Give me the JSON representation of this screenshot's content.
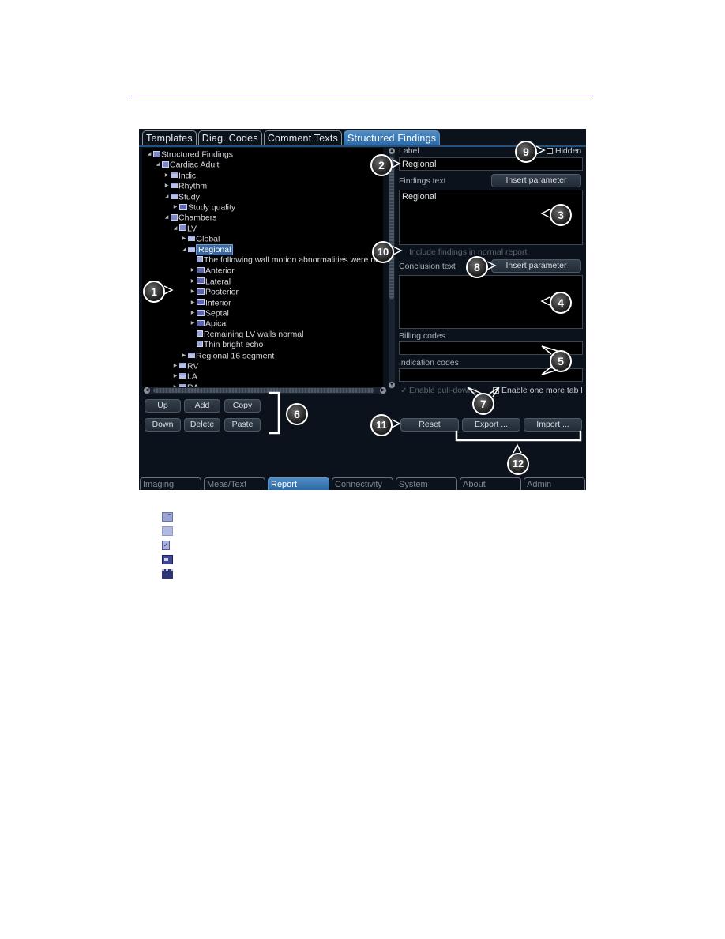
{
  "tabs": [
    {
      "label": "Templates",
      "active": false
    },
    {
      "label": "Diag. Codes",
      "active": false
    },
    {
      "label": "Comment Texts",
      "active": false
    },
    {
      "label": "Structured Findings",
      "active": true
    }
  ],
  "tree": {
    "nodes": [
      {
        "label": "Structured Findings",
        "expanded": true,
        "icon": "group-folder-icon"
      },
      {
        "label": "Cardiac Adult",
        "expanded": true,
        "icon": "group-folder-icon"
      },
      {
        "label": "Indic.",
        "expanded": false,
        "icon": "folder-icon"
      },
      {
        "label": "Rhythm",
        "expanded": false,
        "icon": "folder-icon"
      },
      {
        "label": "Study",
        "expanded": true,
        "icon": "folder-icon"
      },
      {
        "label": "Study quality",
        "expanded": false,
        "icon": "list-icon"
      },
      {
        "label": "Chambers",
        "expanded": true,
        "icon": "group-folder-icon"
      },
      {
        "label": "LV",
        "expanded": true,
        "icon": "group-folder-icon"
      },
      {
        "label": "Global",
        "expanded": false,
        "icon": "folder-icon"
      },
      {
        "label": "Regional",
        "expanded": true,
        "icon": "folder-icon",
        "selected": true
      },
      {
        "label": "The following wall motion abnormalities were note",
        "icon": "item-icon"
      },
      {
        "label": "Anterior",
        "expanded": false,
        "icon": "multi-item-icon"
      },
      {
        "label": "Lateral",
        "expanded": false,
        "icon": "multi-item-icon"
      },
      {
        "label": "Posterior",
        "expanded": false,
        "icon": "multi-item-icon"
      },
      {
        "label": "Inferior",
        "expanded": false,
        "icon": "multi-item-icon"
      },
      {
        "label": "Septal",
        "expanded": false,
        "icon": "multi-item-icon"
      },
      {
        "label": "Apical",
        "expanded": false,
        "icon": "multi-item-icon"
      },
      {
        "label": "Remaining LV walls normal",
        "icon": "item-icon"
      },
      {
        "label": "Thin bright echo",
        "icon": "item-icon"
      },
      {
        "label": "Regional 16 segment",
        "expanded": false,
        "icon": "folder-icon"
      },
      {
        "label": "RV",
        "expanded": false,
        "icon": "folder-icon"
      },
      {
        "label": "LA",
        "expanded": false,
        "icon": "folder-icon"
      },
      {
        "label": "RA",
        "expanded": false,
        "icon": "folder-icon"
      }
    ]
  },
  "tree_buttons": {
    "up": "Up",
    "add": "Add",
    "copy": "Copy",
    "down": "Down",
    "delete": "Delete",
    "paste": "Paste"
  },
  "form": {
    "label_caption": "Label",
    "label_value": "Regional",
    "hidden_label": "Hidden",
    "hidden_checked": false,
    "findings_caption": "Findings text",
    "findings_value": "Regional",
    "insert_parameter": "Insert parameter",
    "include_findings": "Include findings in normal report",
    "conclusion_caption": "Conclusion text",
    "conclusion_value": "",
    "billing_caption": "Billing codes",
    "billing_value": "",
    "indication_caption": "Indication codes",
    "indication_value": "",
    "enable_pulldowns": "Enable pull-downs",
    "enable_pulldowns_checked": true,
    "enable_one_more_tab": "Enable one more tab l",
    "enable_one_more_tab_checked": false
  },
  "actions": {
    "reset": "Reset",
    "export": "Export ...",
    "import": "Import ..."
  },
  "bottom_tabs": [
    {
      "label": "Imaging",
      "active": false
    },
    {
      "label": "Meas/Text",
      "active": false
    },
    {
      "label": "Report",
      "active": true
    },
    {
      "label": "Connectivity",
      "active": false
    },
    {
      "label": "System",
      "active": false
    },
    {
      "label": "About",
      "active": false
    },
    {
      "label": "Admin",
      "active": false
    }
  ],
  "callouts": [
    "1",
    "2",
    "3",
    "4",
    "5",
    "6",
    "7",
    "8",
    "9",
    "10",
    "11",
    "12"
  ],
  "legend_icons": [
    "group-folder-icon",
    "folder-icon",
    "item-icon",
    "multi-item-icon",
    "list-icon"
  ]
}
